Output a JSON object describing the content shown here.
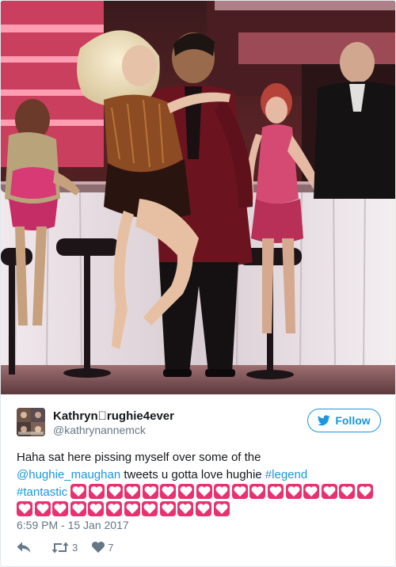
{
  "photo": {
    "alt_icon": "dance-performance-photo"
  },
  "author": {
    "display_name": "Kathryn\u0000rughie4ever",
    "screen_name": "@kathrynannemck",
    "avatar_icon": "avatar-photo"
  },
  "follow": {
    "label": "Follow",
    "icon": "twitter-bird-icon"
  },
  "tweet": {
    "text_1": "Haha sat here pissing myself over some of the",
    "mention": "@hughie_maughan",
    "text_2": " tweets u gotta love hughie ",
    "hashtag_1": "#legend",
    "hashtag_2": "#tantastic",
    "heart_count": 29,
    "heart_icon": "heart-emoji-icon"
  },
  "timestamp": "6:59 PM - 15 Jan 2017",
  "actions": {
    "reply_icon": "reply-icon",
    "retweet_icon": "retweet-icon",
    "retweet_count": "3",
    "like_icon": "heart-icon",
    "like_count": "7"
  },
  "colors": {
    "link": "#1b95e0",
    "secondary_text": "#657786",
    "primary_text": "#14171a",
    "heart_emoji": "#e8326f"
  }
}
